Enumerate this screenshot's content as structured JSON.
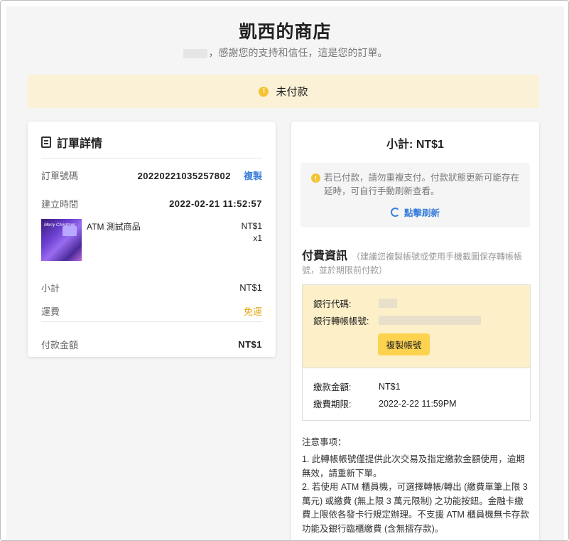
{
  "store": {
    "title": "凱西的商店",
    "thanks": "，感謝您的支持和信任，這是您的訂單。"
  },
  "status": {
    "icon": "warning-icon",
    "label": "未付款"
  },
  "order": {
    "heading": "訂單詳情",
    "order_no_label": "訂單號碼",
    "order_no": "20220221035257802",
    "copy_label": "複製",
    "created_label": "建立時間",
    "created": "2022-02-21 11:52:57",
    "product": {
      "thumb_text": "Merry Christmas",
      "name": "ATM 測試商品",
      "price": "NT$1",
      "qty": "x1"
    },
    "subtotal_label": "小計",
    "subtotal": "NT$1",
    "shipping_label": "運費",
    "shipping": "免運",
    "total_label": "付款金額",
    "total": "NT$1"
  },
  "payment": {
    "subtotal": "小計: NT$1",
    "notice": "若已付款，請勿重複支付。付款狀態更新可能存在延時，可自行手動刷新查看。",
    "refresh_label": "點擊刷新",
    "info_title": "付費資訊",
    "info_hint": "（建議您複製帳號或使用手機截圖保存轉帳帳號，並於期限前付款）",
    "bank_code_label": "銀行代碼:",
    "bank_account_label": "銀行轉帳帳號:",
    "copy_account_label": "複製帳號",
    "amount_label": "繳款金額:",
    "amount": "NT$1",
    "deadline_label": "繳費期限:",
    "deadline": "2022-2-22 11:59PM",
    "notes_title": "注意事项：",
    "notes": [
      "1. 此轉帳帳號僅提供此次交易及指定繳款金額使用，逾期無效，請重新下單。",
      "2. 若使用 ATM 櫃員機，可選擇轉帳/轉出 (繳費單筆上限 3 萬元) 或繳費 (無上限 3 萬元限制) 之功能按鈕。金融卡繳費上限依各發卡行規定辦理。不支援 ATM 櫃員機無卡存款功能及銀行臨櫃繳費 (含無摺存款)。"
    ]
  }
}
